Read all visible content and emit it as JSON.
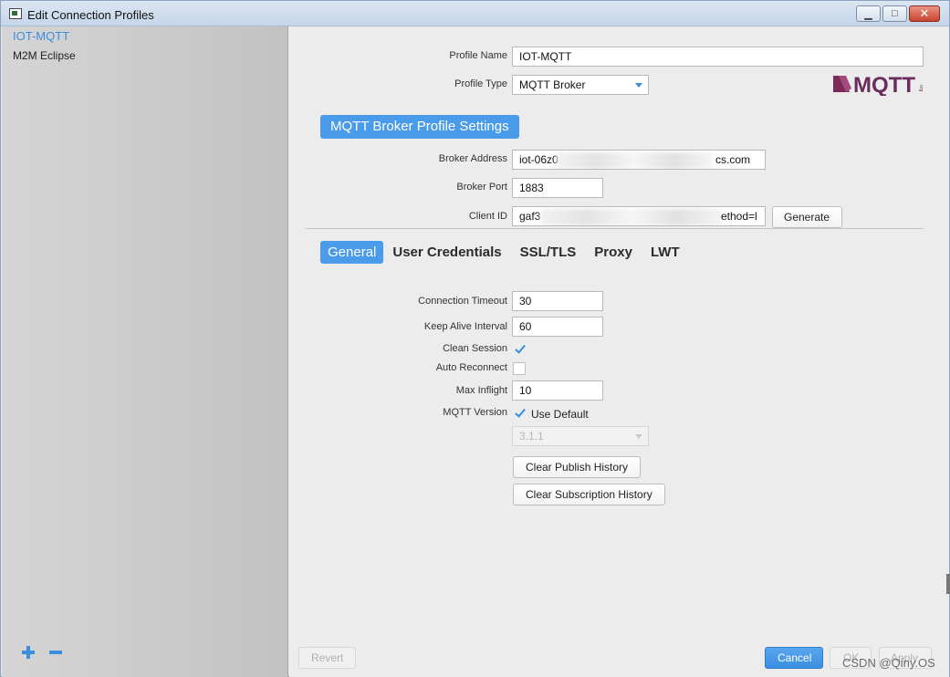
{
  "window": {
    "title": "Edit Connection Profiles",
    "minimize_glyph": "▁",
    "maximize_glyph": "□",
    "close_glyph": "✕"
  },
  "sidebar": {
    "items": [
      {
        "label": "IOT-MQTT",
        "selected": true
      },
      {
        "label": "M2M Eclipse",
        "selected": false
      }
    ]
  },
  "profile": {
    "name_label": "Profile Name",
    "name_value": "IOT-MQTT",
    "type_label": "Profile Type",
    "type_value": "MQTT Broker",
    "logo_text": "MQTT",
    "logo_small": "org"
  },
  "section": {
    "title": "MQTT Broker Profile Settings"
  },
  "broker": {
    "address_label": "Broker Address",
    "address_prefix": "iot-06z0",
    "address_suffix": "cs.com",
    "port_label": "Broker Port",
    "port_value": "1883",
    "client_id_label": "Client ID",
    "client_id_prefix": "gaf3",
    "client_id_suffix": "ethod=l",
    "generate_label": "Generate"
  },
  "tabs": [
    {
      "label": "General",
      "active": true
    },
    {
      "label": "User Credentials",
      "active": false
    },
    {
      "label": "SSL/TLS",
      "active": false
    },
    {
      "label": "Proxy",
      "active": false
    },
    {
      "label": "LWT",
      "active": false
    }
  ],
  "general": {
    "connection_timeout_label": "Connection Timeout",
    "connection_timeout_value": "30",
    "keep_alive_label": "Keep Alive Interval",
    "keep_alive_value": "60",
    "clean_session_label": "Clean Session",
    "clean_session_checked": true,
    "auto_reconnect_label": "Auto Reconnect",
    "auto_reconnect_checked": false,
    "max_inflight_label": "Max Inflight",
    "max_inflight_value": "10",
    "mqtt_version_label": "MQTT Version",
    "use_default_label": "Use Default",
    "use_default_checked": true,
    "version_value": "3.1.1",
    "clear_publish_label": "Clear Publish History",
    "clear_subscription_label": "Clear Subscription History"
  },
  "footer": {
    "revert_label": "Revert",
    "cancel_label": "Cancel",
    "ok_label": "OK",
    "apply_label": "Apply"
  },
  "watermark": "CSDN @Qiny.OS",
  "colors": {
    "accent": "#4a9bea",
    "selected_text": "#3a8ee0",
    "sidebar_bg": "#c8c8c8",
    "panel_bg": "#ececec"
  }
}
